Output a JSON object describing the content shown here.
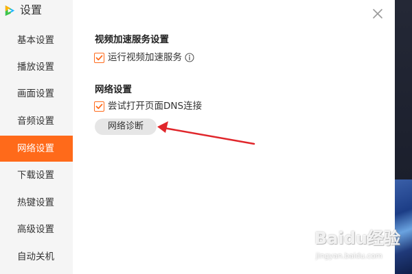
{
  "window": {
    "title": "设置",
    "close_icon": "close-icon",
    "logo_icon": "tencent-video-logo-icon"
  },
  "sidebar": {
    "items": [
      {
        "label": "基本设置",
        "active": false
      },
      {
        "label": "播放设置",
        "active": false
      },
      {
        "label": "画面设置",
        "active": false
      },
      {
        "label": "音频设置",
        "active": false
      },
      {
        "label": "网络设置",
        "active": true
      },
      {
        "label": "下载设置",
        "active": false
      },
      {
        "label": "热键设置",
        "active": false
      },
      {
        "label": "高级设置",
        "active": false
      },
      {
        "label": "自动关机",
        "active": false
      }
    ]
  },
  "main": {
    "video_accel": {
      "title": "视频加速服务设置",
      "checkbox_label": "运行视频加速服务",
      "checked": true,
      "info_icon": "info-icon"
    },
    "network": {
      "title": "网络设置",
      "checkbox_label": "尝试打开页面DNS连接",
      "checked": true,
      "diagnose_button": "网络诊断"
    }
  },
  "watermark": {
    "brand": "Baidu经验",
    "url": "jingyan.baidu.com"
  },
  "colors": {
    "accent": "#ff6a1a",
    "sidebar_bg": "#f5f5f5",
    "arrow": "#e0262b",
    "button_bg": "#e6e6e6"
  }
}
